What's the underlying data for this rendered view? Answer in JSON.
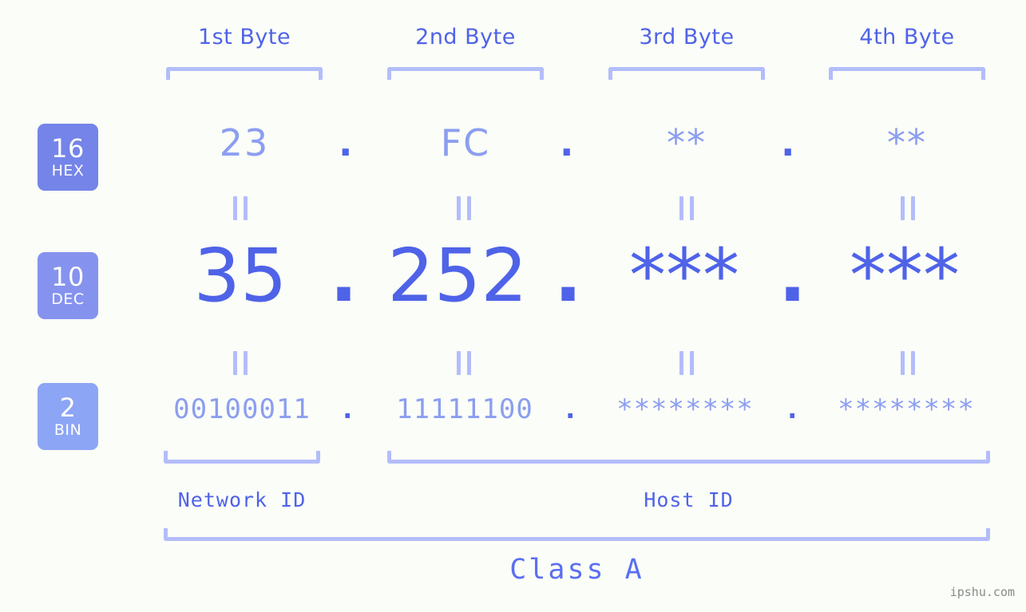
{
  "meta": {
    "background_color": "#fbfdf8",
    "accent_color": "#4f63e8",
    "accent_light_color": "#8b9ef0",
    "bracket_color": "#b3bdfb"
  },
  "headers": [
    {
      "label": "1st Byte"
    },
    {
      "label": "2nd Byte"
    },
    {
      "label": "3rd Byte"
    },
    {
      "label": "4th Byte"
    }
  ],
  "rows": [
    {
      "key": "hex",
      "badge": {
        "base": "16",
        "abbr": "HEX",
        "color": "#7484e8"
      },
      "values": [
        "23",
        "FC",
        "**",
        "**"
      ],
      "separators": [
        ".",
        ".",
        "."
      ]
    },
    {
      "key": "dec",
      "badge": {
        "base": "10",
        "abbr": "DEC",
        "color": "#8593ef"
      },
      "values": [
        "35",
        "252",
        "***",
        "***"
      ],
      "separators": [
        ".",
        ".",
        "."
      ]
    },
    {
      "key": "bin",
      "badge": {
        "base": "2",
        "abbr": "BIN",
        "color": "#8ca5f5"
      },
      "values": [
        "00100011",
        "11111100",
        "********",
        "********"
      ],
      "separators": [
        ".",
        ".",
        "."
      ]
    }
  ],
  "equals": {
    "symbol": "="
  },
  "id_labels": [
    {
      "label": "Network ID"
    },
    {
      "label": "Host ID"
    }
  ],
  "class": {
    "label": "Class A"
  },
  "watermark": {
    "text": "ipshu.com"
  }
}
